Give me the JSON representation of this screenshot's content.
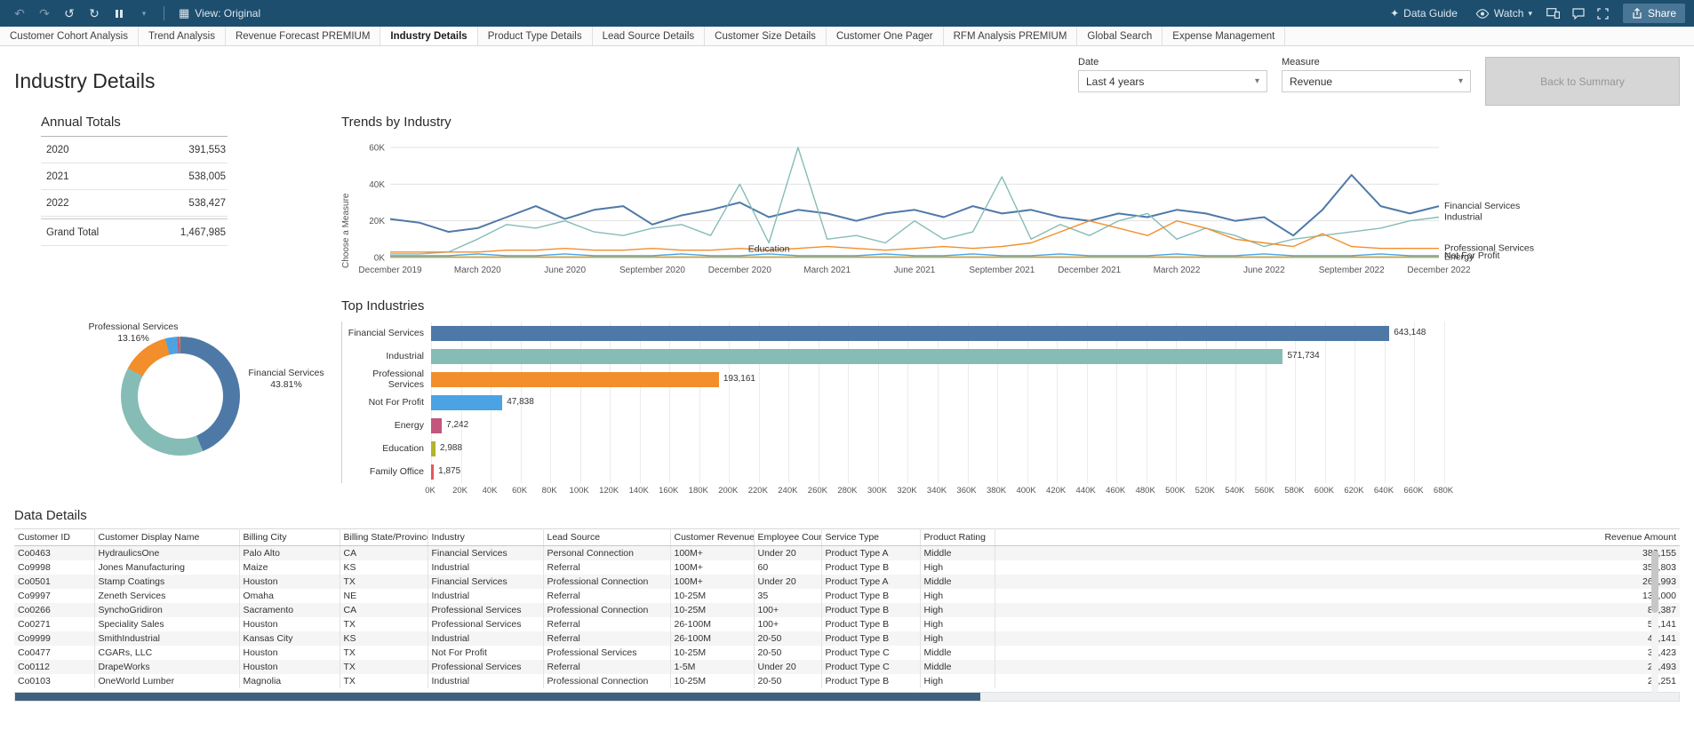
{
  "toolbar": {
    "view_label": "View: Original",
    "data_guide_label": "Data Guide",
    "watch_label": "Watch",
    "share_label": "Share",
    "colors": {
      "bar_bg": "#1d4e6e",
      "share_bg": "#4a7695"
    }
  },
  "tabs": {
    "active_index": 3,
    "items": [
      "Customer Cohort Analysis",
      "Trend Analysis",
      "Revenue Forecast PREMIUM",
      "Industry Details",
      "Product Type Details",
      "Lead Source Details",
      "Customer Size Details",
      "Customer One Pager",
      "RFM Analysis PREMIUM",
      "Global Search",
      "Expense Management"
    ]
  },
  "header": {
    "title": "Industry Details",
    "date_label": "Date",
    "date_value": "Last 4 years",
    "measure_label": "Measure",
    "measure_value": "Revenue",
    "back_button": "Back to Summary"
  },
  "annual_totals": {
    "title": "Annual Totals",
    "rows": [
      [
        "2020",
        "391,553"
      ],
      [
        "2021",
        "538,005"
      ],
      [
        "2022",
        "538,427"
      ]
    ],
    "grand_total": [
      "Grand Total",
      "1,467,985"
    ]
  },
  "chart_data": [
    {
      "id": "trends",
      "type": "line",
      "title": "Trends by Industry",
      "ylabel": "Choose a Measure",
      "ylim": [
        0,
        60000
      ],
      "yticks": [
        "0K",
        "20K",
        "40K",
        "60K"
      ],
      "x_tick_labels": [
        "December 2019",
        "March 2020",
        "June 2020",
        "September 2020",
        "December 2020",
        "March 2021",
        "June 2021",
        "September 2021",
        "December 2021",
        "March 2022",
        "June 2022",
        "September 2022",
        "December 2022"
      ],
      "x_point_count": 37,
      "annotation": {
        "text": "Education",
        "index": 13
      },
      "series": [
        {
          "name": "Financial Services",
          "color": "#4e79a7",
          "end_label": true,
          "values_k": [
            21,
            19,
            14,
            16,
            22,
            28,
            21,
            26,
            28,
            18,
            23,
            26,
            30,
            22,
            26,
            24,
            20,
            24,
            26,
            22,
            28,
            24,
            26,
            22,
            20,
            24,
            22,
            26,
            24,
            20,
            22,
            12,
            26,
            45,
            28,
            24,
            28
          ]
        },
        {
          "name": "Industrial",
          "color": "#86bcb6",
          "end_label": true,
          "values_k": [
            2,
            2,
            3,
            10,
            18,
            16,
            20,
            14,
            12,
            16,
            18,
            12,
            40,
            8,
            60,
            10,
            12,
            8,
            20,
            10,
            14,
            44,
            10,
            18,
            12,
            20,
            24,
            10,
            16,
            12,
            6,
            10,
            12,
            14,
            16,
            20,
            22
          ]
        },
        {
          "name": "Professional Services",
          "color": "#f28e2b",
          "end_label": true,
          "values_k": [
            3,
            3,
            3,
            3,
            4,
            4,
            5,
            4,
            4,
            5,
            4,
            4,
            5,
            4,
            5,
            6,
            5,
            4,
            5,
            6,
            5,
            6,
            8,
            14,
            20,
            16,
            12,
            20,
            16,
            10,
            8,
            6,
            13,
            6,
            5,
            5,
            5
          ]
        },
        {
          "name": "Not For Profit",
          "color": "#4ba3e3",
          "end_label": true,
          "values_k": [
            1,
            1,
            1,
            2,
            1,
            1,
            2,
            1,
            1,
            1,
            2,
            1,
            1,
            2,
            1,
            1,
            1,
            2,
            1,
            1,
            2,
            1,
            1,
            2,
            1,
            1,
            1,
            2,
            1,
            1,
            2,
            1,
            1,
            1,
            2,
            1,
            1
          ]
        },
        {
          "name": "Energy",
          "color": "#c2567c",
          "end_label": true,
          "values_k": [
            0.3,
            0.3,
            0.3,
            0.3,
            0.3,
            0.3,
            0.3,
            0.3,
            0.3,
            0.3,
            0.3,
            0.3,
            0.3,
            0.3,
            0.3,
            0.3,
            0.3,
            0.3,
            0.3,
            0.3,
            0.3,
            0.3,
            0.3,
            0.3,
            0.3,
            0.3,
            0.3,
            0.3,
            0.3,
            0.3,
            0.3,
            0.3,
            0.3,
            0.3,
            0.3,
            0.3,
            0.3
          ]
        },
        {
          "name": "Education",
          "color": "#b3b32e",
          "end_label": false,
          "values_k": [
            0.2,
            0.2,
            0.2,
            0.2,
            0.2,
            0.2,
            0.2,
            0.2,
            0.2,
            0.2,
            0.2,
            0.2,
            0.2,
            0.2,
            0.2,
            0.2,
            0.2,
            0.2,
            0.2,
            0.2,
            0.2,
            0.2,
            0.2,
            0.2,
            0.2,
            0.2,
            0.2,
            0.2,
            0.2,
            0.2,
            0.2,
            0.2,
            0.2,
            0.2,
            0.2,
            0.2,
            0.2
          ]
        }
      ]
    },
    {
      "id": "industry_share",
      "type": "pie",
      "labels": [
        "Financial Services",
        "Industrial",
        "Professional Services",
        "Not For Profit",
        "Energy",
        "Education",
        "Family Office"
      ],
      "values": [
        643148,
        571734,
        193161,
        47838,
        7242,
        2988,
        1875
      ],
      "colors": [
        "#4e79a7",
        "#86bcb6",
        "#f28e2b",
        "#4ba3e3",
        "#c2567c",
        "#b3b32e",
        "#e15759"
      ],
      "callouts": [
        {
          "name": "Professional Services",
          "pct": "13.16%"
        },
        {
          "name": "Financial Services",
          "pct": "43.81%"
        }
      ]
    },
    {
      "id": "top_industries",
      "type": "bar",
      "title": "Top Industries",
      "categories": [
        "Financial Services",
        "Industrial",
        "Professional Services",
        "Not For Profit",
        "Energy",
        "Education",
        "Family Office"
      ],
      "values": [
        643148,
        571734,
        193161,
        47838,
        7242,
        2988,
        1875
      ],
      "value_labels": [
        "643,148",
        "571,734",
        "193,161",
        "47,838",
        "7,242",
        "2,988",
        "1,875"
      ],
      "colors": [
        "#4e79a7",
        "#86bcb6",
        "#f28e2b",
        "#4ba3e3",
        "#c2567c",
        "#b3b32e",
        "#e15759"
      ],
      "xlim": [
        0,
        680000
      ],
      "xticks": [
        "0K",
        "20K",
        "40K",
        "60K",
        "80K",
        "100K",
        "120K",
        "140K",
        "160K",
        "180K",
        "200K",
        "220K",
        "240K",
        "260K",
        "280K",
        "300K",
        "320K",
        "340K",
        "360K",
        "380K",
        "400K",
        "420K",
        "440K",
        "460K",
        "480K",
        "500K",
        "520K",
        "540K",
        "560K",
        "580K",
        "600K",
        "620K",
        "640K",
        "660K",
        "680K"
      ]
    }
  ],
  "data_details": {
    "title": "Data Details",
    "columns": [
      "Customer ID",
      "Customer Display Name",
      "Billing City",
      "Billing State/Province",
      "Industry",
      "Lead Source",
      "Customer Revenue",
      "Employee Count",
      "Service Type",
      "Product Rating",
      "",
      "Revenue Amount"
    ],
    "rows": [
      [
        "Co0463",
        "HydraulicsOne",
        "Palo Alto",
        "CA",
        "Financial Services",
        "Personal Connection",
        "100M+",
        "Under 20",
        "Product Type A",
        "Middle",
        "",
        "382,155"
      ],
      [
        "Co9998",
        "Jones Manufacturing",
        "Maize",
        "KS",
        "Industrial",
        "Referral",
        "100M+",
        "60",
        "Product Type B",
        "High",
        "",
        "352,803"
      ],
      [
        "Co0501",
        "Stamp Coatings",
        "Houston",
        "TX",
        "Financial Services",
        "Professional Connection",
        "100M+",
        "Under 20",
        "Product Type A",
        "Middle",
        "",
        "260,993"
      ],
      [
        "Co9997",
        "Zeneth Services",
        "Omaha",
        "NE",
        "Industrial",
        "Referral",
        "10-25M",
        "35",
        "Product Type B",
        "High",
        "",
        "133,000"
      ],
      [
        "Co0266",
        "SynchoGridiron",
        "Sacramento",
        "CA",
        "Professional Services",
        "Professional Connection",
        "10-25M",
        "100+",
        "Product Type B",
        "High",
        "",
        "81,387"
      ],
      [
        "Co0271",
        "Speciality Sales",
        "Houston",
        "TX",
        "Professional Services",
        "Referral",
        "26-100M",
        "100+",
        "Product Type B",
        "High",
        "",
        "54,141"
      ],
      [
        "Co9999",
        "SmithIndustrial",
        "Kansas City",
        "KS",
        "Industrial",
        "Referral",
        "26-100M",
        "20-50",
        "Product Type B",
        "High",
        "",
        "40,141"
      ],
      [
        "Co0477",
        "CGARs, LLC",
        "Houston",
        "TX",
        "Not For Profit",
        "Professional Services",
        "10-25M",
        "20-50",
        "Product Type C",
        "Middle",
        "",
        "37,423"
      ],
      [
        "Co0112",
        "DrapeWorks",
        "Houston",
        "TX",
        "Professional Services",
        "Referral",
        "1-5M",
        "Under 20",
        "Product Type C",
        "Middle",
        "",
        "25,493"
      ],
      [
        "Co0103",
        "OneWorld Lumber",
        "Magnolia",
        "TX",
        "Industrial",
        "Professional Connection",
        "10-25M",
        "20-50",
        "Product Type B",
        "High",
        "",
        "22,251"
      ]
    ]
  }
}
